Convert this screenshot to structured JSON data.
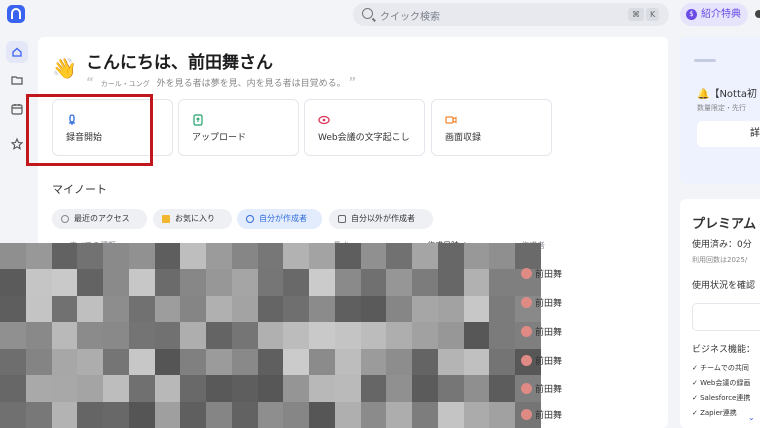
{
  "search": {
    "placeholder": "クイック検索",
    "key1": "⌘",
    "key2": "K"
  },
  "referral": {
    "label": "紹介特典",
    "icon": "$"
  },
  "rail": {
    "items": [
      "home-icon",
      "folder-icon",
      "calendar-icon",
      "star-icon"
    ]
  },
  "greeting": {
    "text": "こんにちは、前田舞さん",
    "emoji": "👋"
  },
  "quote": {
    "author": "カール・ユング",
    "text": "外を見る者は夢を見、内を見る者は目覚める。",
    "open": "“",
    "close": "”"
  },
  "actions": [
    {
      "label": "録音開始",
      "color": "#2f6bdc"
    },
    {
      "label": "アップロード",
      "color": "#22a16a"
    },
    {
      "label": "Web会議の文字起こし",
      "color": "#d8365a"
    },
    {
      "label": "画面収録",
      "color": "#f0822e"
    }
  ],
  "notes": {
    "title": "マイノート",
    "filters": [
      "最近のアクセス",
      "お気に入り",
      "自分が作成者",
      "自分以外が作成者"
    ],
    "selected_filter": "自分が作成者",
    "columns": {
      "type": "すべての種類 ⌄",
      "length": "長さ",
      "created": "作成日時 ↓",
      "creator": "作成者"
    },
    "authors": [
      "前田舞",
      "前田舞",
      "前田舞",
      "前田舞",
      "前田舞",
      "前田舞"
    ]
  },
  "promo": {
    "title": "🔔【Notta初",
    "sub": "数量限定・先行",
    "button": "詳"
  },
  "plan": {
    "title": "プレミアム",
    "used": "使用済み：0分",
    "count": "利用回数は2025/",
    "usage_link": "使用状況を確認",
    "features_title": "ビジネス機能：",
    "features": [
      "チームでの共同",
      "Web会議の録画",
      "Salesforce連携",
      "Zapier連携"
    ]
  }
}
